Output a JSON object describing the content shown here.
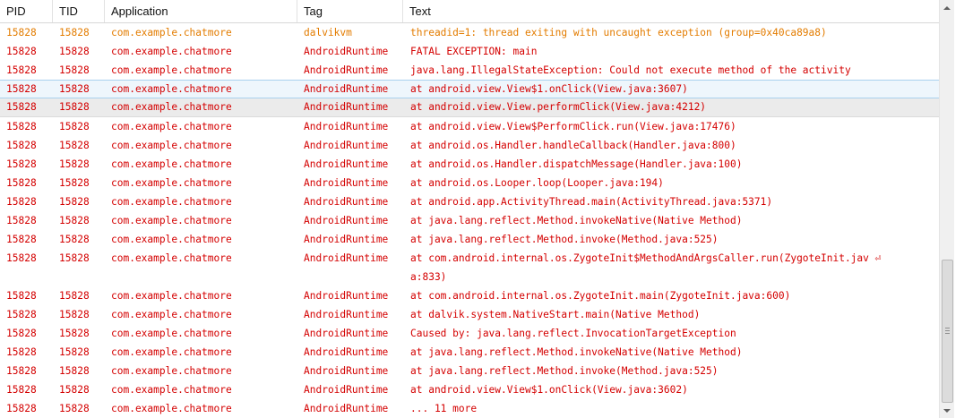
{
  "columns": {
    "pid": "PID",
    "tid": "TID",
    "application": "Application",
    "tag": "Tag",
    "text": "Text"
  },
  "colors": {
    "error": "#d40000",
    "warning": "#e37c00",
    "selected_row_bg": "#eef6fc",
    "highlighted_row_bg": "#ebebeb"
  },
  "rows": [
    {
      "pid": "15828",
      "tid": "15828",
      "app": "com.example.chatmore",
      "tag": "dalvikvm",
      "text": "threadid=1: thread exiting with uncaught exception (group=0x40ca89a8)",
      "level": "warning"
    },
    {
      "pid": "15828",
      "tid": "15828",
      "app": "com.example.chatmore",
      "tag": "AndroidRuntime",
      "text": "FATAL EXCEPTION: main",
      "level": "error"
    },
    {
      "pid": "15828",
      "tid": "15828",
      "app": "com.example.chatmore",
      "tag": "AndroidRuntime",
      "text": "java.lang.IllegalStateException: Could not execute method of the activity",
      "level": "error"
    },
    {
      "pid": "15828",
      "tid": "15828",
      "app": "com.example.chatmore",
      "tag": "AndroidRuntime",
      "text": "at android.view.View$1.onClick(View.java:3607)",
      "level": "error",
      "state": "selected"
    },
    {
      "pid": "15828",
      "tid": "15828",
      "app": "com.example.chatmore",
      "tag": "AndroidRuntime",
      "text": "at android.view.View.performClick(View.java:4212)",
      "level": "error",
      "state": "highlighted"
    },
    {
      "pid": "15828",
      "tid": "15828",
      "app": "com.example.chatmore",
      "tag": "AndroidRuntime",
      "text": "at android.view.View$PerformClick.run(View.java:17476)",
      "level": "error"
    },
    {
      "pid": "15828",
      "tid": "15828",
      "app": "com.example.chatmore",
      "tag": "AndroidRuntime",
      "text": "at android.os.Handler.handleCallback(Handler.java:800)",
      "level": "error"
    },
    {
      "pid": "15828",
      "tid": "15828",
      "app": "com.example.chatmore",
      "tag": "AndroidRuntime",
      "text": "at android.os.Handler.dispatchMessage(Handler.java:100)",
      "level": "error"
    },
    {
      "pid": "15828",
      "tid": "15828",
      "app": "com.example.chatmore",
      "tag": "AndroidRuntime",
      "text": "at android.os.Looper.loop(Looper.java:194)",
      "level": "error"
    },
    {
      "pid": "15828",
      "tid": "15828",
      "app": "com.example.chatmore",
      "tag": "AndroidRuntime",
      "text": "at android.app.ActivityThread.main(ActivityThread.java:5371)",
      "level": "error"
    },
    {
      "pid": "15828",
      "tid": "15828",
      "app": "com.example.chatmore",
      "tag": "AndroidRuntime",
      "text": "at java.lang.reflect.Method.invokeNative(Native Method)",
      "level": "error"
    },
    {
      "pid": "15828",
      "tid": "15828",
      "app": "com.example.chatmore",
      "tag": "AndroidRuntime",
      "text": "at java.lang.reflect.Method.invoke(Method.java:525)",
      "level": "error"
    },
    {
      "pid": "15828",
      "tid": "15828",
      "app": "com.example.chatmore",
      "tag": "AndroidRuntime",
      "text": "at com.android.internal.os.ZygoteInit$MethodAndArgsCaller.run(ZygoteInit.jav ⏎\na:833)",
      "level": "error",
      "wrapped": true
    },
    {
      "pid": "15828",
      "tid": "15828",
      "app": "com.example.chatmore",
      "tag": "AndroidRuntime",
      "text": "at com.android.internal.os.ZygoteInit.main(ZygoteInit.java:600)",
      "level": "error"
    },
    {
      "pid": "15828",
      "tid": "15828",
      "app": "com.example.chatmore",
      "tag": "AndroidRuntime",
      "text": "at dalvik.system.NativeStart.main(Native Method)",
      "level": "error"
    },
    {
      "pid": "15828",
      "tid": "15828",
      "app": "com.example.chatmore",
      "tag": "AndroidRuntime",
      "text": "Caused by: java.lang.reflect.InvocationTargetException",
      "level": "error"
    },
    {
      "pid": "15828",
      "tid": "15828",
      "app": "com.example.chatmore",
      "tag": "AndroidRuntime",
      "text": "at java.lang.reflect.Method.invokeNative(Native Method)",
      "level": "error"
    },
    {
      "pid": "15828",
      "tid": "15828",
      "app": "com.example.chatmore",
      "tag": "AndroidRuntime",
      "text": "at java.lang.reflect.Method.invoke(Method.java:525)",
      "level": "error"
    },
    {
      "pid": "15828",
      "tid": "15828",
      "app": "com.example.chatmore",
      "tag": "AndroidRuntime",
      "text": "at android.view.View$1.onClick(View.java:3602)",
      "level": "error"
    },
    {
      "pid": "15828",
      "tid": "15828",
      "app": "com.example.chatmore",
      "tag": "AndroidRuntime",
      "text": "... 11 more",
      "level": "error"
    }
  ],
  "scrollbar": {
    "up_icon": "arrow-up-icon",
    "down_icon": "arrow-down-icon",
    "position_fraction": 0.9
  }
}
